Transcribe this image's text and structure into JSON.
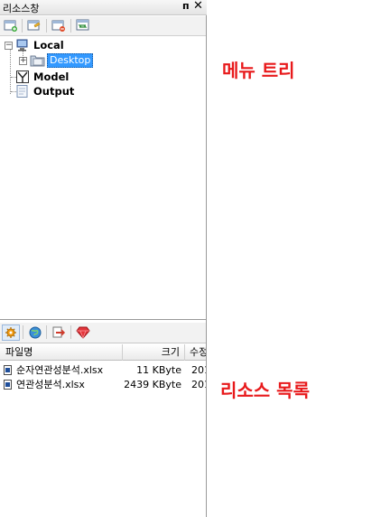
{
  "panel": {
    "title": "리소스창",
    "pin_glyph": "ᴨ",
    "close_glyph": "✕"
  },
  "toolbar": {
    "icons": [
      "new-item-icon",
      "open-folder-icon",
      "delete-item-icon",
      "refresh-icon"
    ]
  },
  "tree": {
    "local": "Local",
    "desktop": "Desktop",
    "model": "Model",
    "output": "Output",
    "expanded_glyph": "−",
    "collapsed_glyph": "+"
  },
  "resource_toolbar": {
    "icons": [
      "settings-icon",
      "globe-icon",
      "export-icon",
      "gem-icon"
    ]
  },
  "list": {
    "columns": [
      "파일명",
      "크기",
      "수정"
    ],
    "rows": [
      {
        "name": "순자연관성분석.xlsx",
        "size": "11 KByte",
        "modified": "201"
      },
      {
        "name": "연관성분석.xlsx",
        "size": "2439 KByte",
        "modified": "201"
      }
    ]
  },
  "annotations": {
    "menu_tree": "메뉴 트리",
    "resource_list": "리소스 목록"
  },
  "colors": {
    "annotation": "#e8191b",
    "selection": "#3399ff"
  }
}
